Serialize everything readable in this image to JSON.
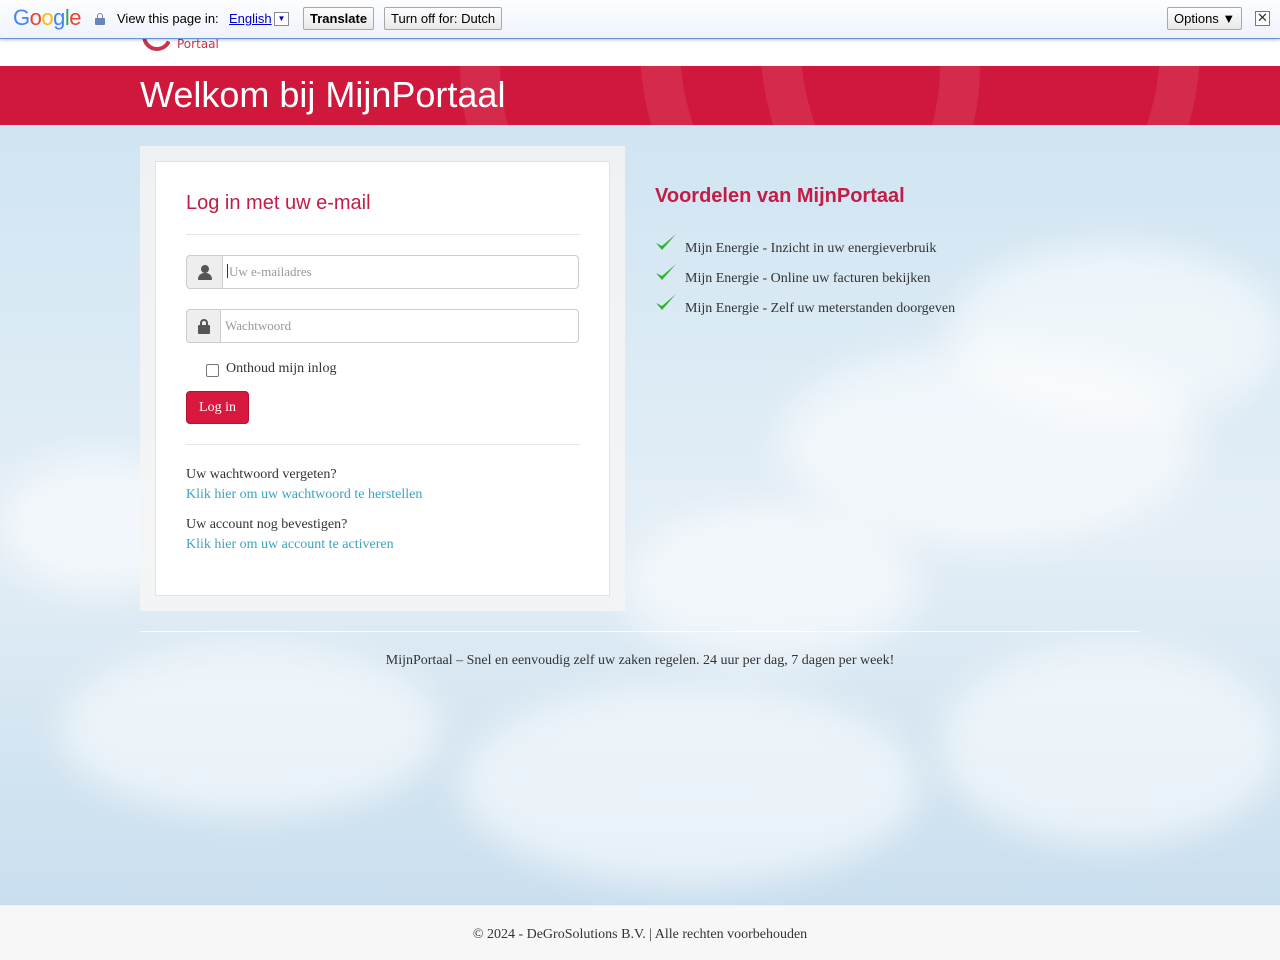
{
  "translate_bar": {
    "logo": "Google",
    "prompt": "View this page in:",
    "language": "English",
    "translate_label": "Translate",
    "turn_off_label": "Turn off for: Dutch",
    "options_label": "Options ▼",
    "close_glyph": "✕"
  },
  "header": {
    "logo_text": "Portaal",
    "banner_title": "Welkom bij MijnPortaal",
    "banner_color": "#d0173c"
  },
  "login": {
    "title": "Log in met uw e-mail",
    "email_placeholder": "Uw e-mailadres",
    "password_placeholder": "Wachtwoord",
    "remember_label": "Onthoud mijn inlog",
    "remember_checked": false,
    "submit_label": "Log in",
    "forgot_question": "Uw wachtwoord vergeten?",
    "forgot_link": "Klik hier om uw wachtwoord te herstellen",
    "activate_question": "Uw account nog bevestigen?",
    "activate_link": "Klik hier om uw account te activeren",
    "accent_color": "#c41c46",
    "link_color": "#3ba3c1"
  },
  "benefits": {
    "title": "Voordelen van MijnPortaal",
    "items": [
      "Mijn Energie - Inzicht in uw energieverbruik",
      "Mijn Energie - Online uw facturen bekijken",
      "Mijn Energie - Zelf uw meterstanden doorgeven"
    ],
    "check_color": "#2db52d"
  },
  "tagline": "MijnPortaal – Snel en eenvoudig zelf uw zaken regelen. 24 uur per dag, 7 dagen per week!",
  "footer": "© 2024 - DeGroSolutions B.V. | Alle rechten voorbehouden"
}
